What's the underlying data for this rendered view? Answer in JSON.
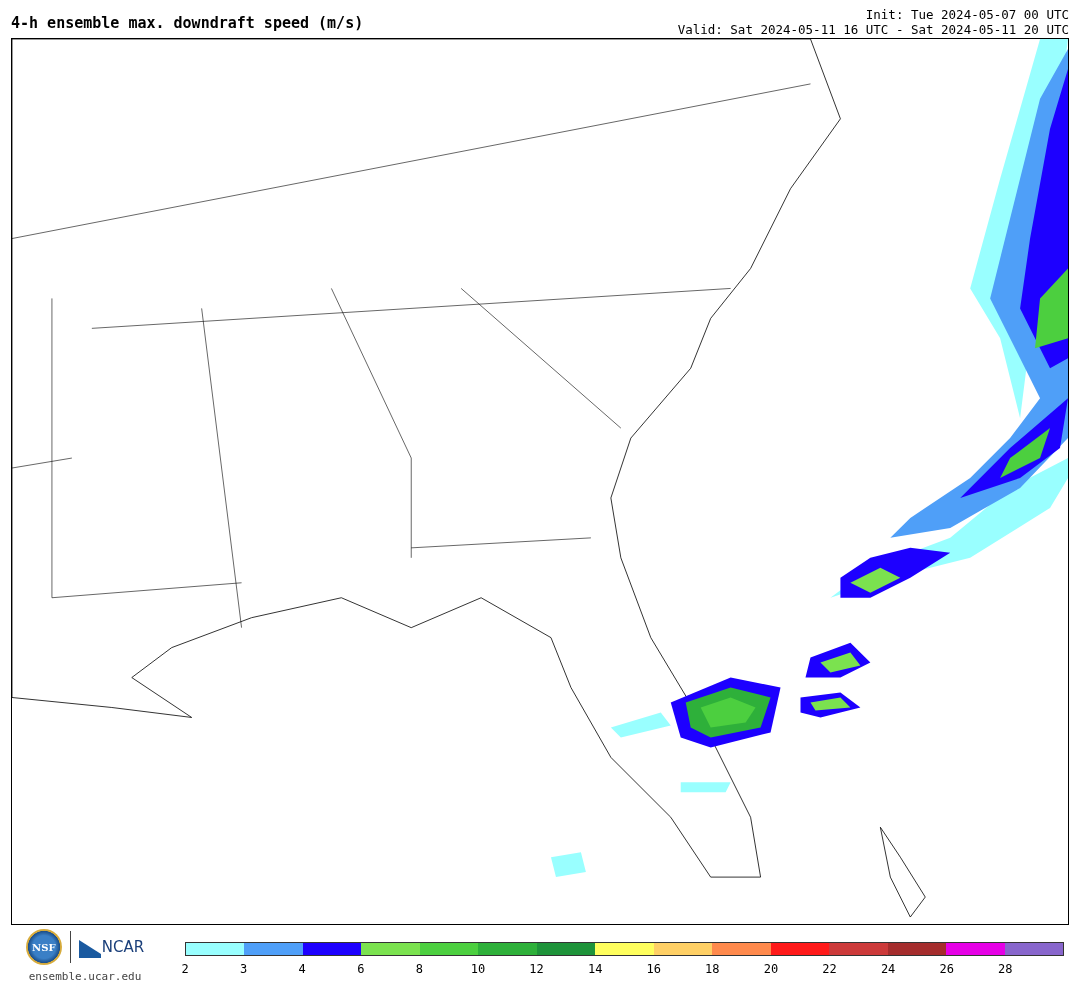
{
  "header": {
    "title": "4-h ensemble max. downdraft speed (m/s)",
    "init": "Init: Tue 2024-05-07 00 UTC",
    "valid": "Valid: Sat 2024-05-11 16 UTC - Sat 2024-05-11 20 UTC"
  },
  "footer": {
    "logos": [
      {
        "kind": "seal",
        "text": "NSF"
      },
      {
        "kind": "wordmark",
        "text": "NCAR"
      }
    ],
    "url": "ensemble.ucar.edu"
  },
  "legend": [
    {
      "label": "2",
      "color": "#99ffff"
    },
    {
      "label": "3",
      "color": "#4f9ff8"
    },
    {
      "label": "4",
      "color": "#1d00ff"
    },
    {
      "label": "6",
      "color": "#7be24f"
    },
    {
      "label": "8",
      "color": "#4ccf3f"
    },
    {
      "label": "10",
      "color": "#2eb03a"
    },
    {
      "label": "12",
      "color": "#1e933a"
    },
    {
      "label": "14",
      "color": "#ffff5e"
    },
    {
      "label": "16",
      "color": "#ffd066"
    },
    {
      "label": "18",
      "color": "#ff8a4d"
    },
    {
      "label": "20",
      "color": "#ff1a1a"
    },
    {
      "label": "22",
      "color": "#cc3a3a"
    },
    {
      "label": "24",
      "color": "#a52d2d"
    },
    {
      "label": "26",
      "color": "#e600e6"
    },
    {
      "label": "28",
      "color": "#8866cc"
    }
  ]
}
